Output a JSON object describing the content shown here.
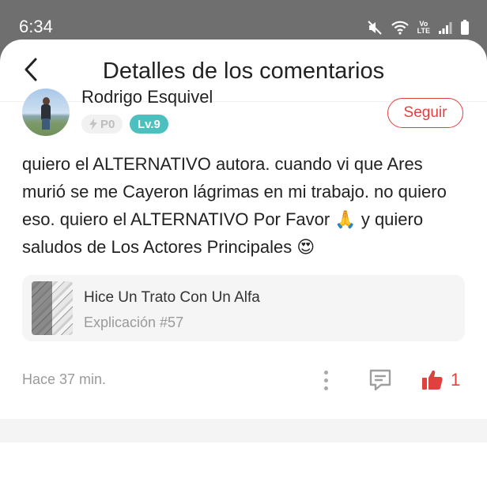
{
  "status_bar": {
    "time": "6:34",
    "icons": [
      "mute-icon",
      "wifi-icon",
      "lte-icon",
      "signal-icon",
      "battery-icon"
    ],
    "lte_top": "Vo",
    "lte_bottom": "LTE"
  },
  "header": {
    "back_icon": "chevron-left-icon",
    "title": "Detalles de los comentarios"
  },
  "comment": {
    "author": "Rodrigo Esquivel",
    "points_badge": "P0",
    "level_badge": "Lv.9",
    "follow_label": "Seguir",
    "text": "quiero el ALTERNATIVO autora. cuando vi que Ares murió se me Cayeron lágrimas en mi trabajo. no quiero eso. quiero el ALTERNATIVO Por Favor 🙏  y quiero saludos de Los Actores Principales 😍",
    "timestamp": "Hace 37 min.",
    "like_count": "1"
  },
  "book": {
    "title": "Hice Un Trato Con Un Alfa",
    "episode": "Explicación #57"
  },
  "colors": {
    "accent": "#e0413f",
    "level_badge": "#4bc0bf",
    "status_bar": "#6f6f6f"
  }
}
